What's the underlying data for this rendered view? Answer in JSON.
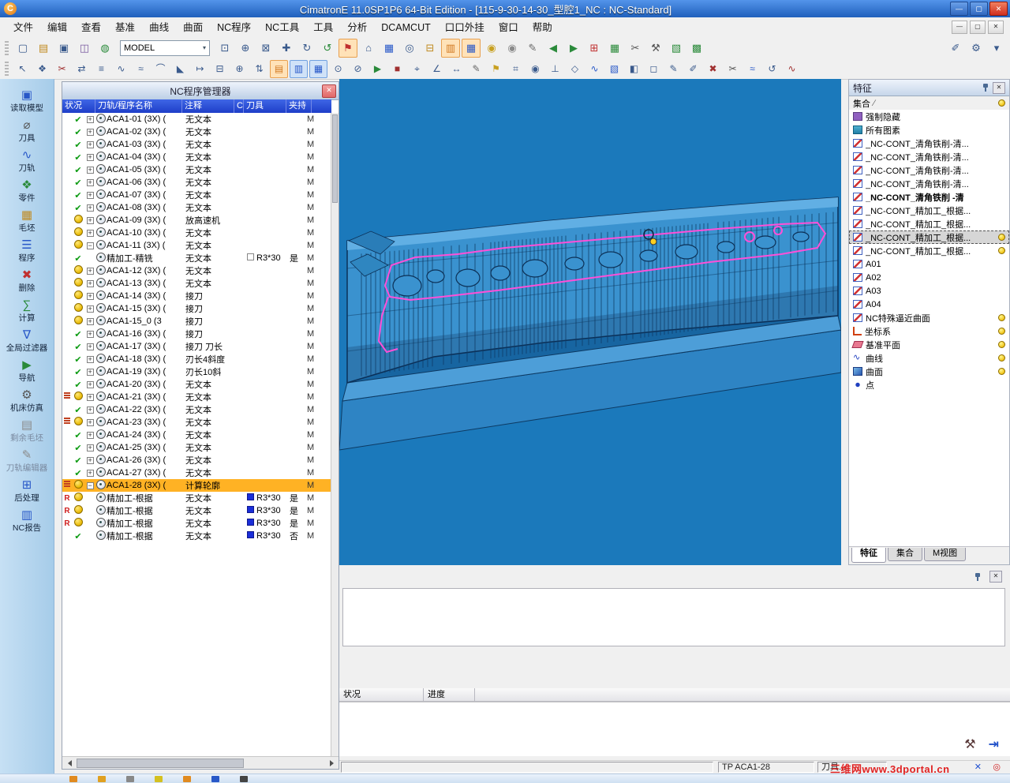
{
  "window": {
    "logo": "C",
    "title": "CimatronE 11.0SP1P6 64-Bit Edition - [115-9-30-14-30_型腔1_NC : NC-Standard]",
    "menus": [
      "文件",
      "编辑",
      "查看",
      "基准",
      "曲线",
      "曲面",
      "NC程序",
      "NC工具",
      "工具",
      "分析",
      "DCAMCUT",
      "口口外挂",
      "窗口",
      "帮助"
    ]
  },
  "glyphs": {
    "close": "✕",
    "minimize": "—",
    "maximize": "▢",
    "dropdown": "▾",
    "slash": "∕"
  },
  "toolbar_main": {
    "model_value": "MODEL",
    "icons_left": [
      {
        "n": "new-document",
        "g": "▢",
        "c": "#3a5a8c"
      },
      {
        "n": "open-file",
        "g": "▤",
        "c": "#c08a20"
      },
      {
        "n": "save-file",
        "g": "▣",
        "c": "#3a5a8c"
      },
      {
        "n": "import-model",
        "g": "◫",
        "c": "#7a5aa0"
      },
      {
        "n": "world-view",
        "g": "◍",
        "c": "#2a8a3a"
      }
    ],
    "icons_mid": [
      {
        "n": "select-window",
        "g": "⊡",
        "c": "#3a5a8c"
      },
      {
        "n": "zoom-in",
        "g": "⊕",
        "c": "#3a5a8c"
      },
      {
        "n": "zoom-fit",
        "g": "⊠",
        "c": "#3a5a8c"
      },
      {
        "n": "pan-view",
        "g": "✚",
        "c": "#3a5a8c"
      },
      {
        "n": "rotate-view",
        "g": "↻",
        "c": "#3a5a8c"
      },
      {
        "n": "redraw-view",
        "g": "↺",
        "c": "#2a8a3a"
      },
      {
        "n": "flag-marker",
        "g": "⚑",
        "c": "#c03030",
        "b": "o"
      },
      {
        "n": "home-view",
        "g": "⌂",
        "c": "#3a5a8c"
      },
      {
        "n": "simulation",
        "g": "▦",
        "c": "#2858c8"
      },
      {
        "n": "target-point",
        "g": "◎",
        "c": "#3a5a8c"
      },
      {
        "n": "document-stack",
        "g": "⊟",
        "c": "#c08a20"
      },
      {
        "n": "nc-document",
        "g": "▥",
        "c": "#d07820",
        "b": "o"
      },
      {
        "n": "nc-process",
        "g": "▦",
        "c": "#2858c8",
        "b": "o"
      },
      {
        "n": "lamp-on",
        "g": "◉",
        "c": "#c8a020"
      },
      {
        "n": "lamp-off",
        "g": "◉",
        "c": "#8a8a8a"
      },
      {
        "n": "annotation",
        "g": "✎",
        "c": "#666666"
      },
      {
        "n": "step-back",
        "g": "◀",
        "c": "#2a8a3a"
      },
      {
        "n": "step-forward",
        "g": "▶",
        "c": "#2a8a3a"
      },
      {
        "n": "apps-grid",
        "g": "⊞",
        "c": "#c03030"
      },
      {
        "n": "mesh-grid",
        "g": "▦",
        "c": "#2a8a3a"
      },
      {
        "n": "cut-tool",
        "g": "✂",
        "c": "#555555"
      },
      {
        "n": "machine-tools",
        "g": "⚒",
        "c": "#555555"
      },
      {
        "n": "stock-box",
        "g": "▧",
        "c": "#2a8a3a"
      },
      {
        "n": "stock-box-2",
        "g": "▩",
        "c": "#2a8a3a"
      }
    ],
    "icons_right": [
      {
        "n": "sketch-pen",
        "g": "✐",
        "c": "#3a5a8c"
      },
      {
        "n": "settings-gear",
        "g": "⚙",
        "c": "#3a5a8c"
      },
      {
        "n": "more-options",
        "g": "▾",
        "c": "#3a5a8c"
      }
    ]
  },
  "toolbar_second": {
    "icons": [
      {
        "n": "select-arrow",
        "g": "↖",
        "c": "#3a5a8c"
      },
      {
        "n": "multi-select",
        "g": "❖",
        "c": "#3a5a8c"
      },
      {
        "n": "quick-trim",
        "g": "✂",
        "c": "#a03030"
      },
      {
        "n": "mirror-geometry",
        "g": "⇄",
        "c": "#3a5a8c"
      },
      {
        "n": "offset-curves",
        "g": "≡",
        "c": "#3a5a8c"
      },
      {
        "n": "sweep-curve",
        "g": "∿",
        "c": "#3a5a8c"
      },
      {
        "n": "approximate-curve",
        "g": "≈",
        "c": "#3a5a8c"
      },
      {
        "n": "arc-fillet",
        "g": "⌒",
        "c": "#3a5a8c"
      },
      {
        "n": "chamfer-corner",
        "g": "◣",
        "c": "#3a5a8c"
      },
      {
        "n": "extend-curve",
        "g": "↦",
        "c": "#3a5a8c"
      },
      {
        "n": "split-entity",
        "g": "⊟",
        "c": "#3a5a8c"
      },
      {
        "n": "merge-entity",
        "g": "⊕",
        "c": "#3a5a8c"
      },
      {
        "n": "reorder-list",
        "g": "⇅",
        "c": "#3a5a8c"
      },
      {
        "n": "toolpath-display",
        "g": "▤",
        "c": "#d07820",
        "b": "o"
      },
      {
        "n": "toolpath-edit",
        "g": "▥",
        "c": "#2858c8",
        "b": "b"
      },
      {
        "n": "toolpath-verify",
        "g": "▦",
        "c": "#2858c8",
        "b": "b"
      },
      {
        "n": "info-query",
        "g": "⊙",
        "c": "#3a5a8c"
      },
      {
        "n": "lock-entity",
        "g": "⊘",
        "c": "#3a5a8c"
      },
      {
        "n": "run-process",
        "g": "▶",
        "c": "#2a8a3a"
      },
      {
        "n": "stop-process",
        "g": "■",
        "c": "#a03030"
      },
      {
        "n": "measure-point",
        "g": "⌖",
        "c": "#3a5a8c"
      },
      {
        "n": "measure-angle",
        "g": "∠",
        "c": "#3a5a8c"
      },
      {
        "n": "measure-distance",
        "g": "↔",
        "c": "#3a5a8c"
      },
      {
        "n": "edit-note",
        "g": "✎",
        "c": "#666666"
      },
      {
        "n": "bookmark-flag",
        "g": "⚑",
        "c": "#c8a020"
      },
      {
        "n": "snap-grid",
        "g": "⌗",
        "c": "#3a5a8c"
      },
      {
        "n": "snap-center",
        "g": "◉",
        "c": "#3a5a8c"
      },
      {
        "n": "axis-normal",
        "g": "⊥",
        "c": "#3a5a8c"
      },
      {
        "n": "datum-plane",
        "g": "◇",
        "c": "#3a5a8c"
      },
      {
        "n": "curve-tool",
        "g": "∿",
        "c": "#2858c8"
      },
      {
        "n": "surface-tool",
        "g": "▧",
        "c": "#2858c8"
      },
      {
        "n": "shaded-view",
        "g": "◧",
        "c": "#3a5a8c"
      },
      {
        "n": "wireframe-view",
        "g": "◻",
        "c": "#3a5a8c"
      },
      {
        "n": "draw-pencil",
        "g": "✎",
        "c": "#3a5a8c"
      },
      {
        "n": "draw-pen",
        "g": "✐",
        "c": "#3a5a8c"
      },
      {
        "n": "delete-entity",
        "g": "✖",
        "c": "#a03030"
      },
      {
        "n": "trim-scissors",
        "g": "✂",
        "c": "#555555"
      },
      {
        "n": "wave-curve",
        "g": "≈",
        "c": "#2858c8"
      },
      {
        "n": "spin-view",
        "g": "↺",
        "c": "#3a5a8c"
      },
      {
        "n": "zigzag-path",
        "g": "∿",
        "c": "#a03030"
      }
    ]
  },
  "sidebar": {
    "items": [
      {
        "label": "读取模型",
        "icon": "load-model",
        "g": "▣",
        "c": "#2858c8"
      },
      {
        "label": "刀具",
        "icon": "tools",
        "g": "⌀",
        "c": "#555555"
      },
      {
        "label": "刀轨",
        "icon": "toolpath",
        "g": "∿",
        "c": "#2858c8"
      },
      {
        "label": "零件",
        "icon": "part",
        "g": "❖",
        "c": "#2a8a3a"
      },
      {
        "label": "毛坯",
        "icon": "stock",
        "g": "▦",
        "c": "#c08a20"
      },
      {
        "label": "程序",
        "icon": "program",
        "g": "☰",
        "c": "#2858c8"
      },
      {
        "label": "删除",
        "icon": "delete",
        "g": "✖",
        "c": "#c03030"
      },
      {
        "label": "计算",
        "icon": "calculate",
        "g": "∑",
        "c": "#2a8a3a"
      },
      {
        "label": "全局过滤器",
        "icon": "global-filter",
        "g": "∇",
        "c": "#2858c8"
      },
      {
        "label": "导航",
        "icon": "navigate",
        "g": "▶",
        "c": "#2a8a3a"
      },
      {
        "label": "机床仿真",
        "icon": "machine-sim",
        "g": "⚙",
        "c": "#555555"
      },
      {
        "label": "剩余毛坯",
        "icon": "rest-stock",
        "g": "▤",
        "c": "#8a8a8a",
        "dim": true
      },
      {
        "label": "刀轨编辑器",
        "icon": "toolpath-editor",
        "g": "✎",
        "c": "#8a8a8a",
        "dim": true
      },
      {
        "label": "后处理",
        "icon": "post-process",
        "g": "⊞",
        "c": "#2858c8"
      },
      {
        "label": "NC报告",
        "icon": "nc-report",
        "g": "▥",
        "c": "#2858c8"
      }
    ]
  },
  "nc_manager": {
    "title": "NC程序管理器",
    "columns": [
      "状况",
      "刀轨/程序名称",
      "注释",
      "C",
      "刀具",
      "夹持"
    ],
    "rows": [
      {
        "m": "",
        "s": "ok",
        "e": "+",
        "name": "ACA1-01 (3X) (",
        "note": "无文本",
        "r": "M"
      },
      {
        "m": "",
        "s": "ok",
        "e": "+",
        "name": "ACA1-02 (3X) (",
        "note": "无文本",
        "r": "M"
      },
      {
        "m": "",
        "s": "ok",
        "e": "+",
        "name": "ACA1-03 (3X) (",
        "note": "无文本",
        "r": "M"
      },
      {
        "m": "",
        "s": "ok",
        "e": "+",
        "name": "ACA1-04 (3X) (",
        "note": "无文本",
        "r": "M"
      },
      {
        "m": "",
        "s": "ok",
        "e": "+",
        "name": "ACA1-05 (3X) (",
        "note": "无文本",
        "r": "M"
      },
      {
        "m": "",
        "s": "ok",
        "e": "+",
        "name": "ACA1-06 (3X) (",
        "note": "无文本",
        "r": "M"
      },
      {
        "m": "",
        "s": "ok",
        "e": "+",
        "name": "ACA1-07 (3X) (",
        "note": "无文本",
        "r": "M"
      },
      {
        "m": "",
        "s": "ok",
        "e": "+",
        "name": "ACA1-08 (3X) (",
        "note": "无文本",
        "r": "M"
      },
      {
        "m": "",
        "s": "warn",
        "e": "+",
        "name": "ACA1-09 (3X) (",
        "note": "放高速机",
        "r": "M"
      },
      {
        "m": "",
        "s": "warn",
        "e": "+",
        "name": "ACA1-10 (3X) (",
        "note": "无文本",
        "r": "M"
      },
      {
        "m": "",
        "s": "warn",
        "e": "-",
        "name": "ACA1-11 (3X) (",
        "note": "无文本",
        "r": "M"
      },
      {
        "m": "",
        "s": "ok",
        "e": "",
        "child": true,
        "name": "精加工-精铣",
        "note": "无文本",
        "sw": "empty",
        "tool": "R3*30",
        "flag": "是",
        "r": "M"
      },
      {
        "m": "",
        "s": "warn",
        "e": "+",
        "name": "ACA1-12 (3X) (",
        "note": "无文本",
        "r": "M"
      },
      {
        "m": "",
        "s": "warn",
        "e": "+",
        "name": "ACA1-13 (3X) (",
        "note": "无文本",
        "r": "M"
      },
      {
        "m": "",
        "s": "warn",
        "e": "+",
        "name": "ACA1-14 (3X) (",
        "note": "接刀",
        "r": "M"
      },
      {
        "m": "",
        "s": "warn",
        "e": "+",
        "name": "ACA1-15 (3X) (",
        "note": "接刀",
        "r": "M"
      },
      {
        "m": "",
        "s": "warn",
        "e": "+",
        "name": "ACA1-15_0 (3",
        "note": "接刀",
        "r": "M"
      },
      {
        "m": "",
        "s": "ok",
        "e": "+",
        "name": "ACA1-16 (3X) (",
        "note": "接刀",
        "r": "M"
      },
      {
        "m": "",
        "s": "ok",
        "e": "+",
        "name": "ACA1-17 (3X) (",
        "note": "接刀 刀长",
        "r": "M"
      },
      {
        "m": "",
        "s": "ok",
        "e": "+",
        "name": "ACA1-18 (3X) (",
        "note": "刃长4斜度",
        "r": "M"
      },
      {
        "m": "",
        "s": "ok",
        "e": "+",
        "name": "ACA1-19 (3X) (",
        "note": "刃长10斜",
        "r": "M"
      },
      {
        "m": "",
        "s": "ok",
        "e": "+",
        "name": "ACA1-20 (3X) (",
        "note": "无文本",
        "r": "M"
      },
      {
        "m": "lines",
        "s": "warn",
        "e": "+",
        "name": "ACA1-21 (3X) (",
        "note": "无文本",
        "r": "M"
      },
      {
        "m": "",
        "s": "ok",
        "e": "+",
        "name": "ACA1-22 (3X) (",
        "note": "无文本",
        "r": "M"
      },
      {
        "m": "lines",
        "s": "warn",
        "e": "+",
        "name": "ACA1-23 (3X) (",
        "note": "无文本",
        "r": "M"
      },
      {
        "m": "",
        "s": "ok",
        "e": "+",
        "name": "ACA1-24 (3X) (",
        "note": "无文本",
        "r": "M"
      },
      {
        "m": "",
        "s": "ok",
        "e": "+",
        "name": "ACA1-25 (3X) (",
        "note": "无文本",
        "r": "M"
      },
      {
        "m": "",
        "s": "ok",
        "e": "+",
        "name": "ACA1-26 (3X) (",
        "note": "无文本",
        "r": "M"
      },
      {
        "m": "",
        "s": "ok",
        "e": "+",
        "name": "ACA1-27 (3X) (",
        "note": "无文本",
        "r": "M"
      },
      {
        "m": "lines",
        "s": "warn",
        "e": "-",
        "name": "ACA1-28 (3X) (",
        "note": "计算轮廓",
        "sel": true,
        "r": "M"
      },
      {
        "m": "R",
        "s": "warn",
        "e": "",
        "child": true,
        "name": "精加工-根据",
        "note": "无文本",
        "sw": "blue",
        "tool": "R3*30",
        "flag": "是",
        "r": "M"
      },
      {
        "m": "R",
        "s": "warn",
        "e": "",
        "child": true,
        "name": "精加工-根据",
        "note": "无文本",
        "sw": "blue",
        "tool": "R3*30",
        "flag": "是",
        "r": "M"
      },
      {
        "m": "R",
        "s": "warn",
        "e": "",
        "child": true,
        "name": "精加工-根据",
        "note": "无文本",
        "sw": "blue",
        "tool": "R3*30",
        "flag": "是",
        "r": "M"
      },
      {
        "m": "",
        "s": "ok",
        "e": "",
        "child": true,
        "name": "精加工-根据",
        "note": "无文本",
        "sw": "blue",
        "tool": "R3*30",
        "flag": "否",
        "r": "M"
      }
    ]
  },
  "viewport": {
    "background": "#1b79bb",
    "model_color": "#3a92cf",
    "toolpath_color": "#ff4fd8"
  },
  "features": {
    "title": "特征",
    "column_header": "集合",
    "items": [
      {
        "label": "强制隐藏",
        "icon": "hide"
      },
      {
        "label": "所有图素",
        "icon": "all"
      },
      {
        "label": "_NC-CONT_清角铁削-清...",
        "icon": "set"
      },
      {
        "label": "_NC-CONT_清角铁削-清...",
        "icon": "set"
      },
      {
        "label": "_NC-CONT_清角铁削-清...",
        "icon": "set"
      },
      {
        "label": "_NC-CONT_清角铁削-清...",
        "icon": "set"
      },
      {
        "label": "_NC-CONT_清角铁削 -清",
        "icon": "set",
        "bold": true
      },
      {
        "label": "_NC-CONT_精加工_根据...",
        "icon": "set"
      },
      {
        "label": "_NC-CONT_精加工_根据...",
        "icon": "set"
      },
      {
        "label": "_NC-CONT_精加工_根据...",
        "icon": "set",
        "selected": true,
        "bulb": true
      },
      {
        "label": "_NC-CONT_精加工_根据...",
        "icon": "set",
        "bulb": true
      },
      {
        "label": "A01",
        "icon": "set"
      },
      {
        "label": "A02",
        "icon": "set"
      },
      {
        "label": "A03",
        "icon": "set"
      },
      {
        "label": "A04",
        "icon": "set"
      },
      {
        "label": "NC特殊逼近曲面",
        "icon": "set",
        "bulb": true
      },
      {
        "label": "坐标系",
        "icon": "ucs",
        "bulb": true
      },
      {
        "label": "基准平面",
        "icon": "plane",
        "bulb": true
      },
      {
        "label": "曲线",
        "icon": "curve",
        "bulb": true
      },
      {
        "label": "曲面",
        "icon": "surface",
        "bulb": true
      },
      {
        "label": "点",
        "icon": "point"
      }
    ],
    "tabs": [
      {
        "id": "features",
        "label": "特征",
        "active": true
      },
      {
        "id": "sets",
        "label": "集合"
      },
      {
        "id": "mview",
        "label": "M视图"
      }
    ]
  },
  "bottom_panel": {
    "columns": [
      "状况",
      "进度"
    ]
  },
  "status_bar": {
    "tp": "TP  ACA1-28",
    "tool": "刀具...",
    "watermark": "三维网www.3dportal.cn"
  },
  "taskbar": {
    "icons": [
      "#e08a20",
      "#e0a020",
      "#888888",
      "#d4c020",
      "#e08a20",
      "#2858c8",
      "#444444"
    ]
  }
}
